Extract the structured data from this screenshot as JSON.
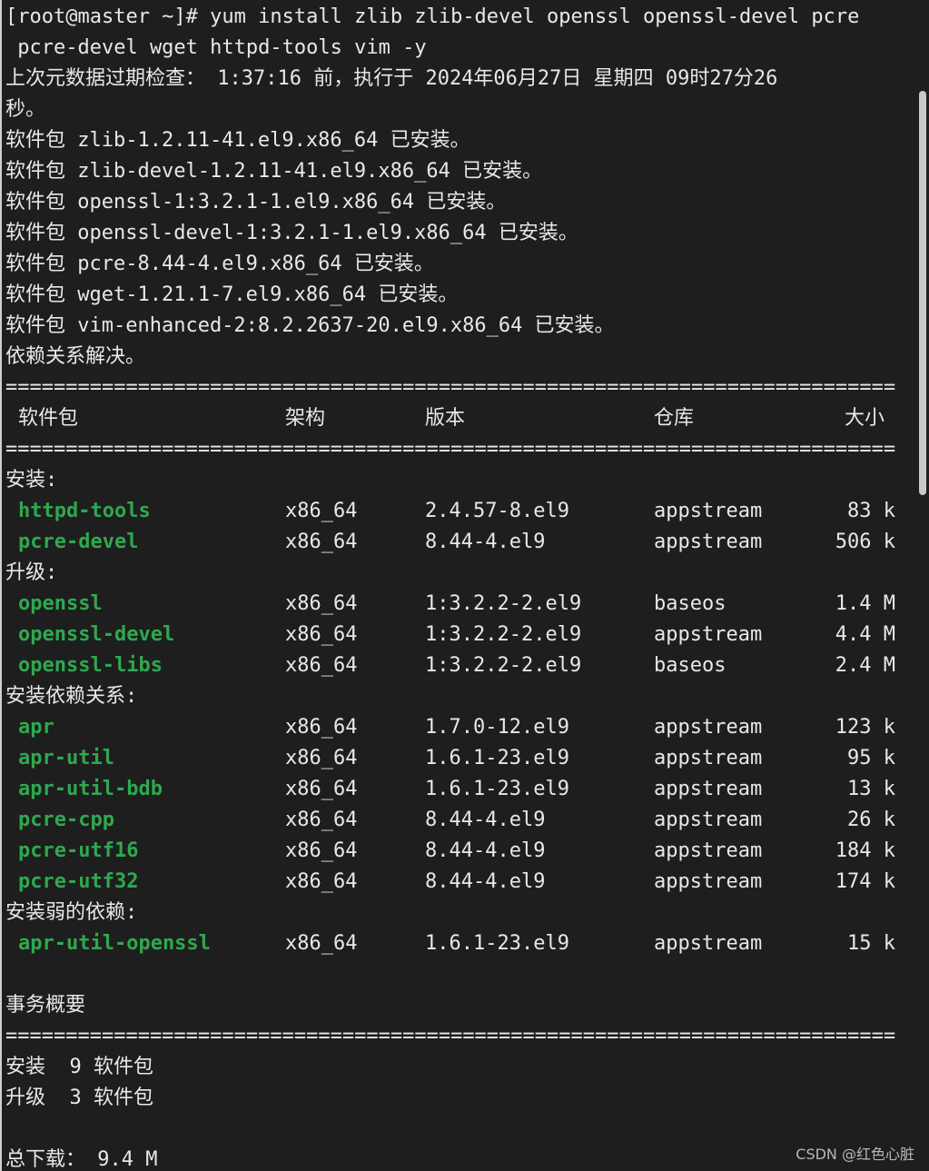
{
  "terminal": {
    "cmd_line1": "[root@master ~]# yum install zlib zlib-devel openssl openssl-devel pcre",
    "cmd_line2": " pcre-devel wget httpd-tools vim -y",
    "meta_line1": "上次元数据过期检查： 1:37:16 前，执行于 2024年06月27日 星期四 09时27分26",
    "meta_line2": "秒。",
    "installed": [
      "软件包 zlib-1.2.11-41.el9.x86_64 已安装。",
      "软件包 zlib-devel-1.2.11-41.el9.x86_64 已安装。",
      "软件包 openssl-1:3.2.1-1.el9.x86_64 已安装。",
      "软件包 openssl-devel-1:3.2.1-1.el9.x86_64 已安装。",
      "软件包 pcre-8.44-4.el9.x86_64 已安装。",
      "软件包 wget-1.21.1-7.el9.x86_64 已安装。",
      "软件包 vim-enhanced-2:8.2.2637-20.el9.x86_64 已安装。"
    ],
    "deps_resolved": "依赖关系解决。",
    "separator": "==========================================================================",
    "headers": {
      "package": "软件包",
      "arch": "架构",
      "version": "版本",
      "repo": "仓库",
      "size": "大小"
    },
    "sections": {
      "install": "安装:",
      "upgrade": "升级:",
      "install_deps": "安装依赖关系:",
      "install_weak_deps": "安装弱的依赖:"
    },
    "rows": {
      "install": [
        {
          "name": "httpd-tools",
          "arch": "x86_64",
          "version": "2.4.57-8.el9",
          "repo": "appstream",
          "size": "83 k"
        },
        {
          "name": "pcre-devel",
          "arch": "x86_64",
          "version": "8.44-4.el9",
          "repo": "appstream",
          "size": "506 k"
        }
      ],
      "upgrade": [
        {
          "name": "openssl",
          "arch": "x86_64",
          "version": "1:3.2.2-2.el9",
          "repo": "baseos",
          "size": "1.4 M"
        },
        {
          "name": "openssl-devel",
          "arch": "x86_64",
          "version": "1:3.2.2-2.el9",
          "repo": "appstream",
          "size": "4.4 M"
        },
        {
          "name": "openssl-libs",
          "arch": "x86_64",
          "version": "1:3.2.2-2.el9",
          "repo": "baseos",
          "size": "2.4 M"
        }
      ],
      "install_deps": [
        {
          "name": "apr",
          "arch": "x86_64",
          "version": "1.7.0-12.el9",
          "repo": "appstream",
          "size": "123 k"
        },
        {
          "name": "apr-util",
          "arch": "x86_64",
          "version": "1.6.1-23.el9",
          "repo": "appstream",
          "size": "95 k"
        },
        {
          "name": "apr-util-bdb",
          "arch": "x86_64",
          "version": "1.6.1-23.el9",
          "repo": "appstream",
          "size": "13 k"
        },
        {
          "name": "pcre-cpp",
          "arch": "x86_64",
          "version": "8.44-4.el9",
          "repo": "appstream",
          "size": "26 k"
        },
        {
          "name": "pcre-utf16",
          "arch": "x86_64",
          "version": "8.44-4.el9",
          "repo": "appstream",
          "size": "184 k"
        },
        {
          "name": "pcre-utf32",
          "arch": "x86_64",
          "version": "8.44-4.el9",
          "repo": "appstream",
          "size": "174 k"
        }
      ],
      "install_weak_deps": [
        {
          "name": "apr-util-openssl",
          "arch": "x86_64",
          "version": "1.6.1-23.el9",
          "repo": "appstream",
          "size": "15 k"
        }
      ]
    },
    "summary_title": "事务概要",
    "summary_install": "安装  9 软件包",
    "summary_upgrade": "升级  3 软件包",
    "total_download": "总下载： 9.4 M"
  },
  "watermark": "CSDN @红色心脏",
  "colors": {
    "background": "#1e1e1e",
    "text": "#e8e8e8",
    "package_name": "#2fa84f"
  }
}
